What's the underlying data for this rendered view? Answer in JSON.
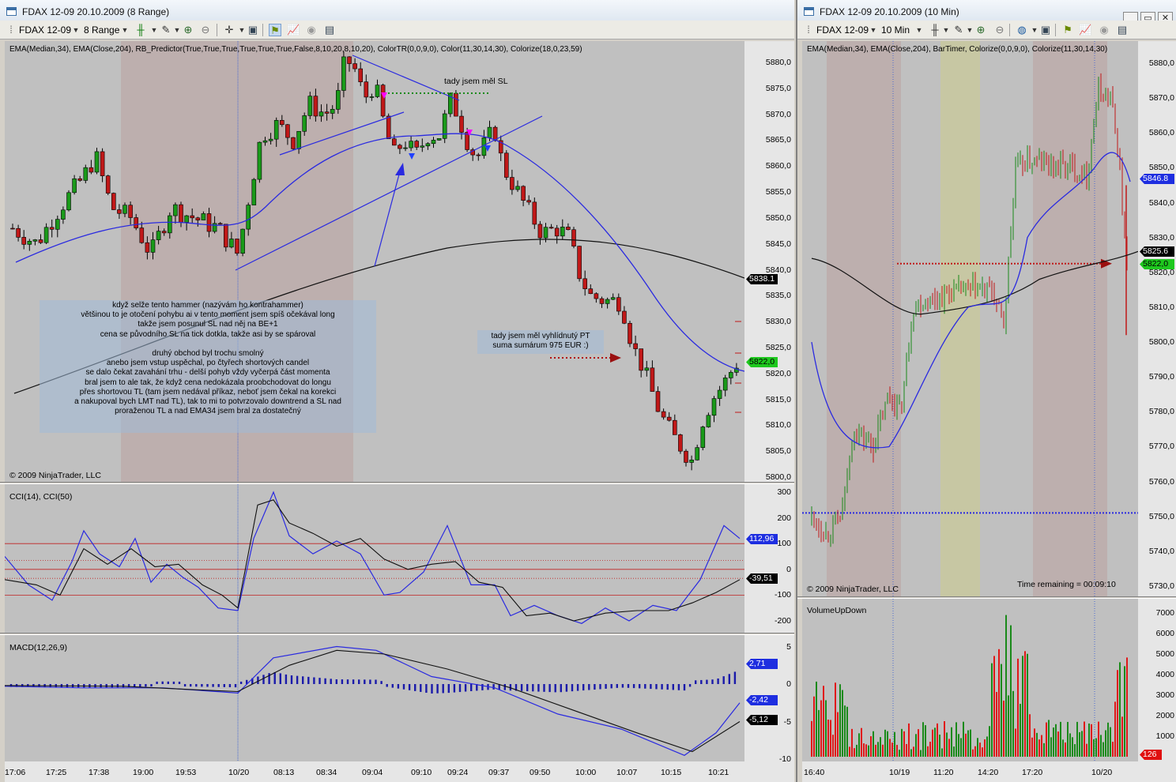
{
  "left": {
    "title": "FDAX 12-09  20.10.2009 (8 Range)",
    "toolbar": {
      "instrument": "FDAX 12-09",
      "period": "8 Range"
    },
    "price": {
      "indicator_label": "EMA(Median,34), EMA(Close,204), RB_Predictor(True,True,True,True,True,True,False,8,10,20,8,10,20), ColorTR(0,0,9,0), Color(11,30,14,30), Colorize(18,0,23,59)",
      "copyright": "© 2009 NinjaTrader, LLC",
      "y_ticks": [
        "5880,0",
        "5875,0",
        "5870,0",
        "5865,0",
        "5860,0",
        "5855,0",
        "5850,0",
        "5845,0",
        "5840,0",
        "5835,0",
        "5830,0",
        "5825,0",
        "5820,0",
        "5815,0",
        "5810,0",
        "5805,0",
        "5800,0"
      ],
      "flag_ema204": "5838.1",
      "flag_last": "5822,0",
      "note_sl": "tady jsem měl SL",
      "note_pt": [
        "tady jsem měl vyhlídnutý PT",
        "suma sumárum 975 EUR :)"
      ],
      "note_main": [
        "když selže tento hammer (nazývám ho kontrahammer)",
        "většinou to je otočení pohybu  ai v tento moment jsem spíš očekával long",
        "takže jsem posunul SL nad něj na BE+1",
        "cena se původního SL na tick dotkla, takže asi by se spároval",
        "",
        "druhý obchod byl trochu smolný",
        "anebo jsem vstup uspěchal, po čtyřech shortových candel",
        "se dalo čekat zavahání trhu - delší pohyb vždy vyčerpá část momenta",
        "bral jsem to ale tak, že když cena nedokázala proobchodovat do longu",
        "přes shortovou TL (tam jsem nedával příkaz, neboť jsem čekal na korekci",
        "a nakupoval bych LMT nad TL), tak to mi to potvrzovalo downtrend a SL nad",
        "proraženou TL a nad EMA34 jsem bral za dostatečný"
      ]
    },
    "cci": {
      "label": "CCI(14), CCI(50)",
      "y_ticks": [
        "300",
        "200",
        "100",
        "0",
        "-100",
        "-200"
      ],
      "flag_a": "112,96",
      "flag_b": "-39,51"
    },
    "macd": {
      "label": "MACD(12,26,9)",
      "y_ticks": [
        "5",
        "0",
        "-5",
        "-10"
      ],
      "flag_a": "2,71",
      "flag_b": "-2,42",
      "flag_c": "-5,12"
    },
    "x_ticks": [
      "17:06",
      "17:25",
      "17:38",
      "19:00",
      "19:53",
      "10/20",
      "08:13",
      "08:34",
      "09:04",
      "09:10",
      "09:24",
      "09:37",
      "09:50",
      "10:00",
      "10:07",
      "10:15",
      "10:21"
    ]
  },
  "right": {
    "title": "FDAX 12-09  20.10.2009 (10 Min)",
    "toolbar": {
      "instrument": "FDAX 12-09",
      "period": "10 Min"
    },
    "price": {
      "indicator_label": "EMA(Median,34), EMA(Close,204), BarTimer, Colorize(0,0,9,0), Colorize(11,30,14,30)",
      "copyright": "© 2009 NinjaTrader, LLC",
      "time_remaining": "Time remaining = 00:09:10",
      "y_ticks": [
        "5880,0",
        "5870,0",
        "5860,0",
        "5850,0",
        "5840,0",
        "5830,0",
        "5820,0",
        "5810,0",
        "5800,0",
        "5790,0",
        "5780,0",
        "5770,0",
        "5760,0",
        "5750,0",
        "5740,0",
        "5730,0"
      ],
      "flag_ema34": "5846.8",
      "flag_ema204": "5825.6",
      "flag_last": "5822,0"
    },
    "volume": {
      "label": "VolumeUpDown",
      "y_ticks": [
        "7000",
        "6000",
        "5000",
        "4000",
        "3000",
        "2000",
        "1000"
      ],
      "flag": "126"
    },
    "x_ticks": [
      "16:40",
      "10/19",
      "11:20",
      "14:20",
      "17:20",
      "10/20"
    ]
  },
  "colors": {
    "up": "#1a8a1a",
    "down": "#c01818",
    "ema34": "#2222dd",
    "ema204": "#111111",
    "session_shade": "#bcaaa8",
    "highlight": "#c8c8a0",
    "note_bg": "#a8c0dc"
  }
}
